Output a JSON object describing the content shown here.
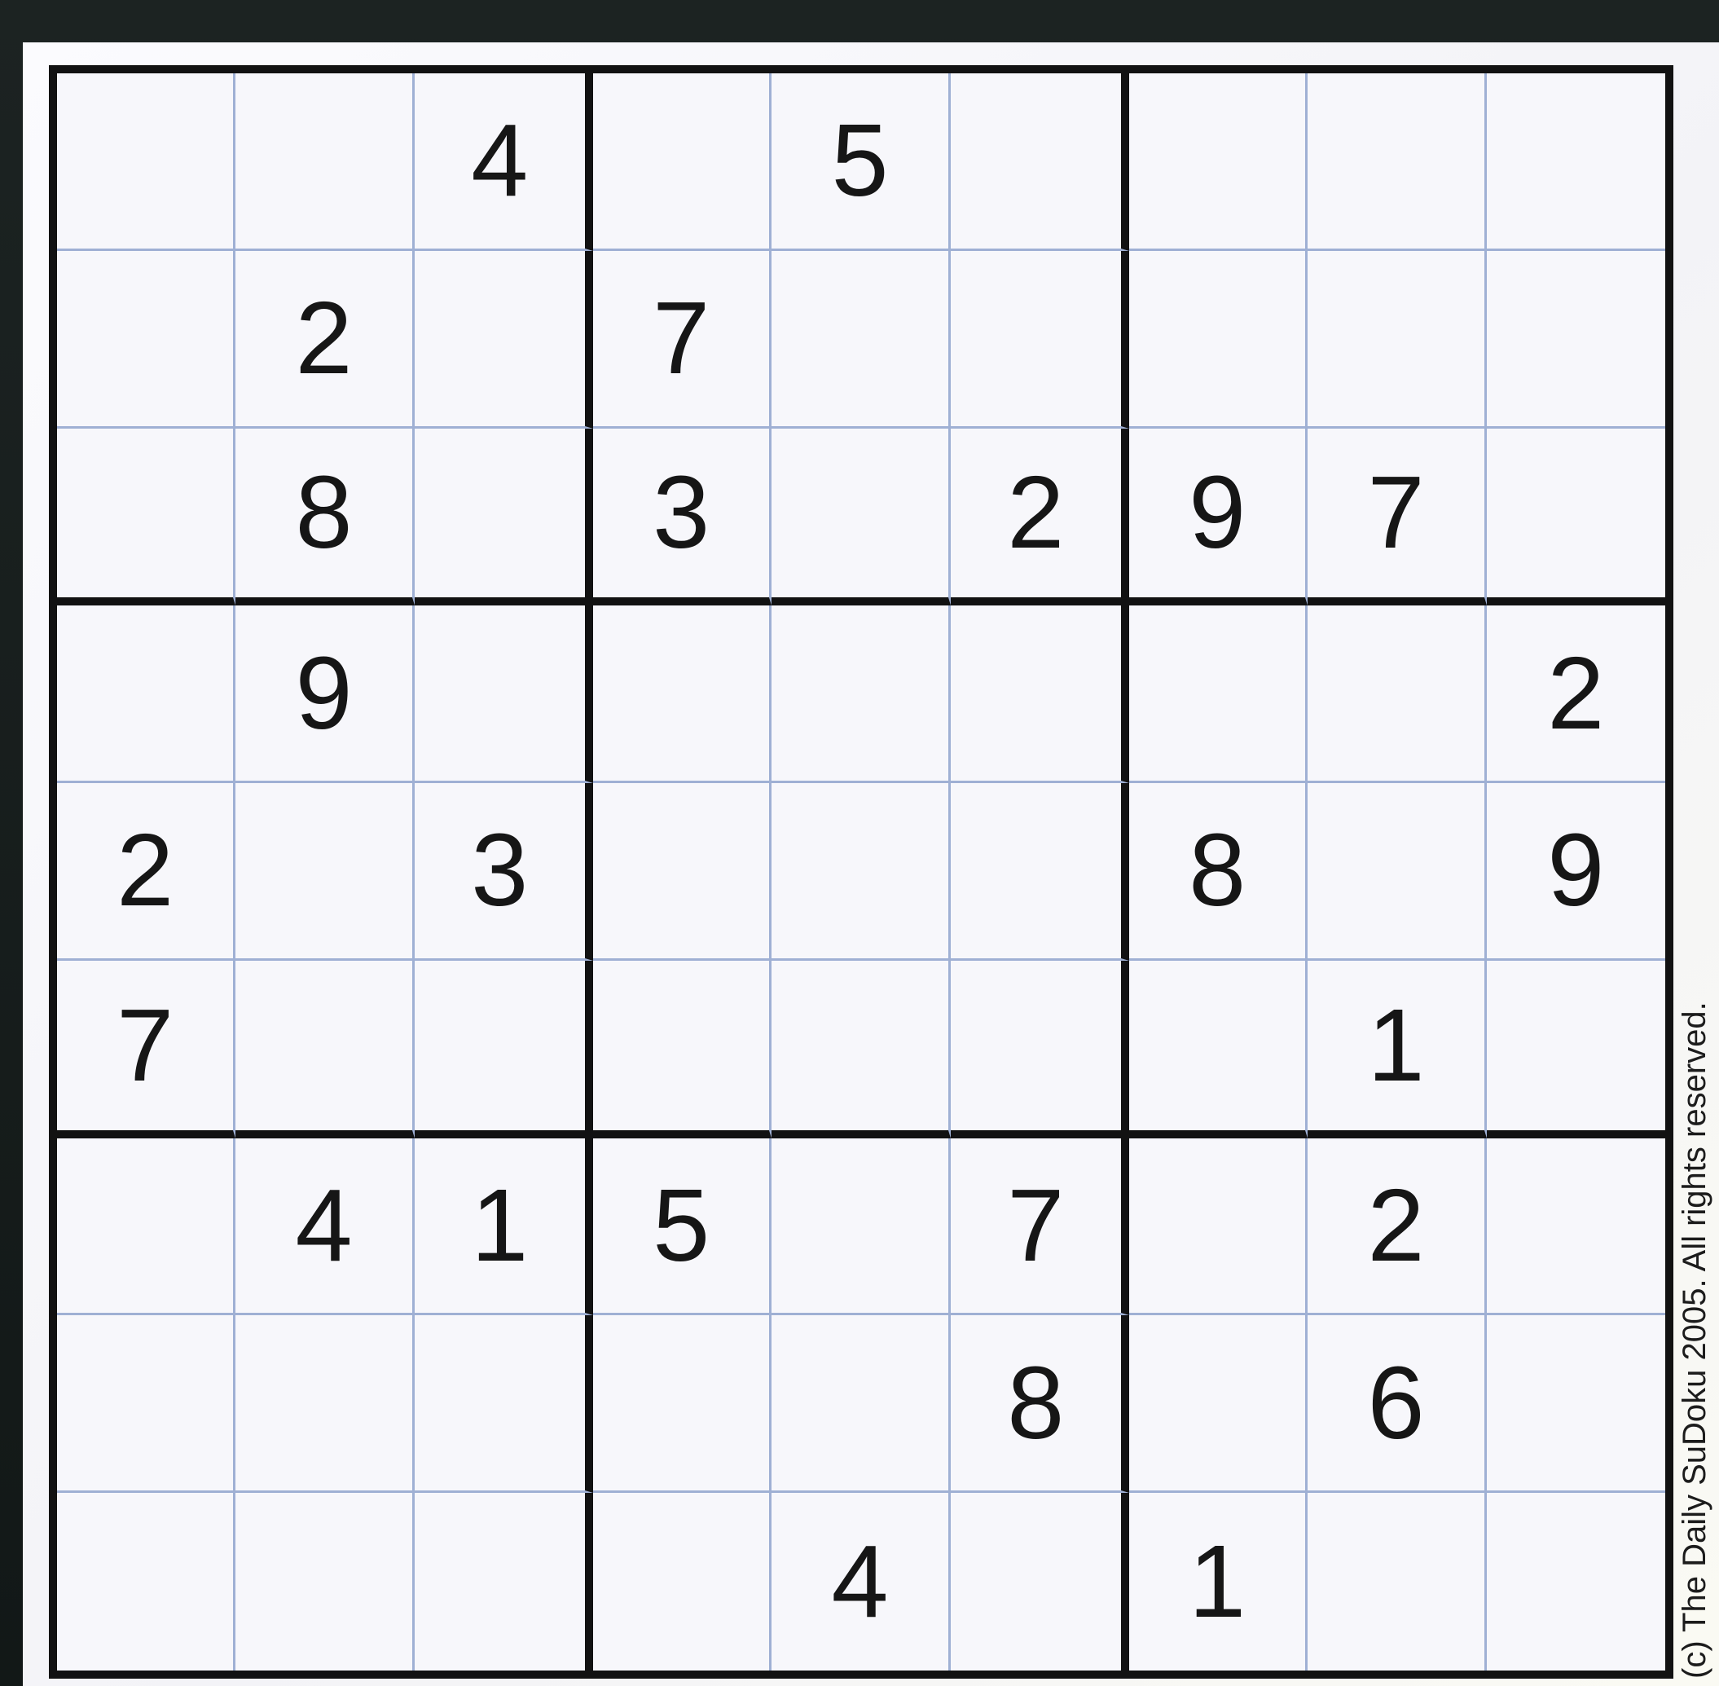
{
  "puzzle": {
    "grid": [
      [
        "",
        "",
        "4",
        "",
        "5",
        "",
        "",
        "",
        ""
      ],
      [
        "",
        "2",
        "",
        "7",
        "",
        "",
        "",
        "",
        ""
      ],
      [
        "",
        "8",
        "",
        "3",
        "",
        "2",
        "9",
        "7",
        ""
      ],
      [
        "",
        "9",
        "",
        "",
        "",
        "",
        "",
        "",
        "2"
      ],
      [
        "2",
        "",
        "3",
        "",
        "",
        "",
        "8",
        "",
        "9"
      ],
      [
        "7",
        "",
        "",
        "",
        "",
        "",
        "",
        "1",
        ""
      ],
      [
        "",
        "4",
        "1",
        "5",
        "",
        "7",
        "",
        "2",
        ""
      ],
      [
        "",
        "",
        "",
        "",
        "",
        "8",
        "",
        "6",
        ""
      ],
      [
        "",
        "",
        "",
        "",
        "4",
        "",
        "1",
        "",
        ""
      ]
    ]
  },
  "footer": {
    "copyright": "(c) The Daily SuDoku 2005. All rights reserved."
  },
  "colors": {
    "thin_line": "#9fb0d4",
    "thick_line": "#121212",
    "digit": "#161616",
    "paper": "#f7f7fb"
  }
}
